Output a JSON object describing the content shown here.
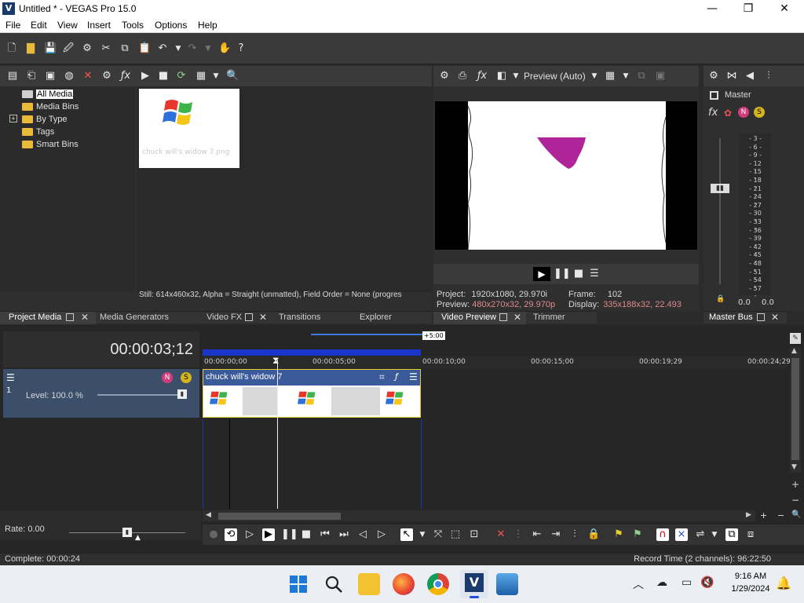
{
  "window": {
    "title": "Untitled * - VEGAS Pro 15.0",
    "app_letter": "V"
  },
  "menu": [
    "File",
    "Edit",
    "View",
    "Insert",
    "Tools",
    "Options",
    "Help"
  ],
  "project_media": {
    "tree": [
      "All Media",
      "Media Bins",
      "By Type",
      "Tags",
      "Smart Bins"
    ],
    "expander": "+",
    "thumbnail_label": "chuck will's widow 7.png",
    "status": "Still: 614x460x32, Alpha = Straight (unmatted), Field Order = None (progres"
  },
  "dock_tabs_left": [
    "Project Media",
    "Media Generators",
    "Video FX",
    "Transitions",
    "Explorer"
  ],
  "video_preview": {
    "mode": "Preview (Auto)",
    "project_label": "Project:",
    "project_value": "1920x1080, 29.970i",
    "preview_label": "Preview:",
    "preview_value": "480x270x32, 29.970p",
    "frame_label": "Frame:",
    "frame_value": "102",
    "display_label": "Display:",
    "display_value": "335x188x32, 22.493"
  },
  "dock_tabs_mid": [
    "Video Preview",
    "Trimmer"
  ],
  "master_bus": {
    "label": "Master",
    "fx_label": "fx",
    "scale": [
      "3",
      "6",
      "9",
      "12",
      "15",
      "18",
      "21",
      "24",
      "27",
      "30",
      "33",
      "36",
      "39",
      "42",
      "45",
      "48",
      "51",
      "54",
      "57"
    ],
    "left_value": "0.0",
    "right_value": "0.0",
    "tab": "Master Bus"
  },
  "timeline": {
    "timecode": "00:00:03;12",
    "zoom_marker": "+5:00",
    "track_level": "Level: 100.0 %",
    "track_number": "1",
    "clip_name": "chuck will's widow 7",
    "ruler": [
      "00:00:00;00",
      "00:00:05;00",
      "00:00:10;00",
      "00:00:15;00",
      "00:00:19;29",
      "00:00:24;29"
    ],
    "rate": "Rate: 0.00"
  },
  "status_bar": {
    "complete": "Complete: 00:00:24",
    "record_time": "Record Time (2 channels): 96:22:50"
  },
  "taskbar": {
    "time": "9:16 AM",
    "date": "1/29/2024"
  },
  "colors": {
    "accent": "#1f4fd8",
    "clip_header": "#3b5a9a",
    "magenta": "#b0249a",
    "pin": "#e6cc2e"
  }
}
